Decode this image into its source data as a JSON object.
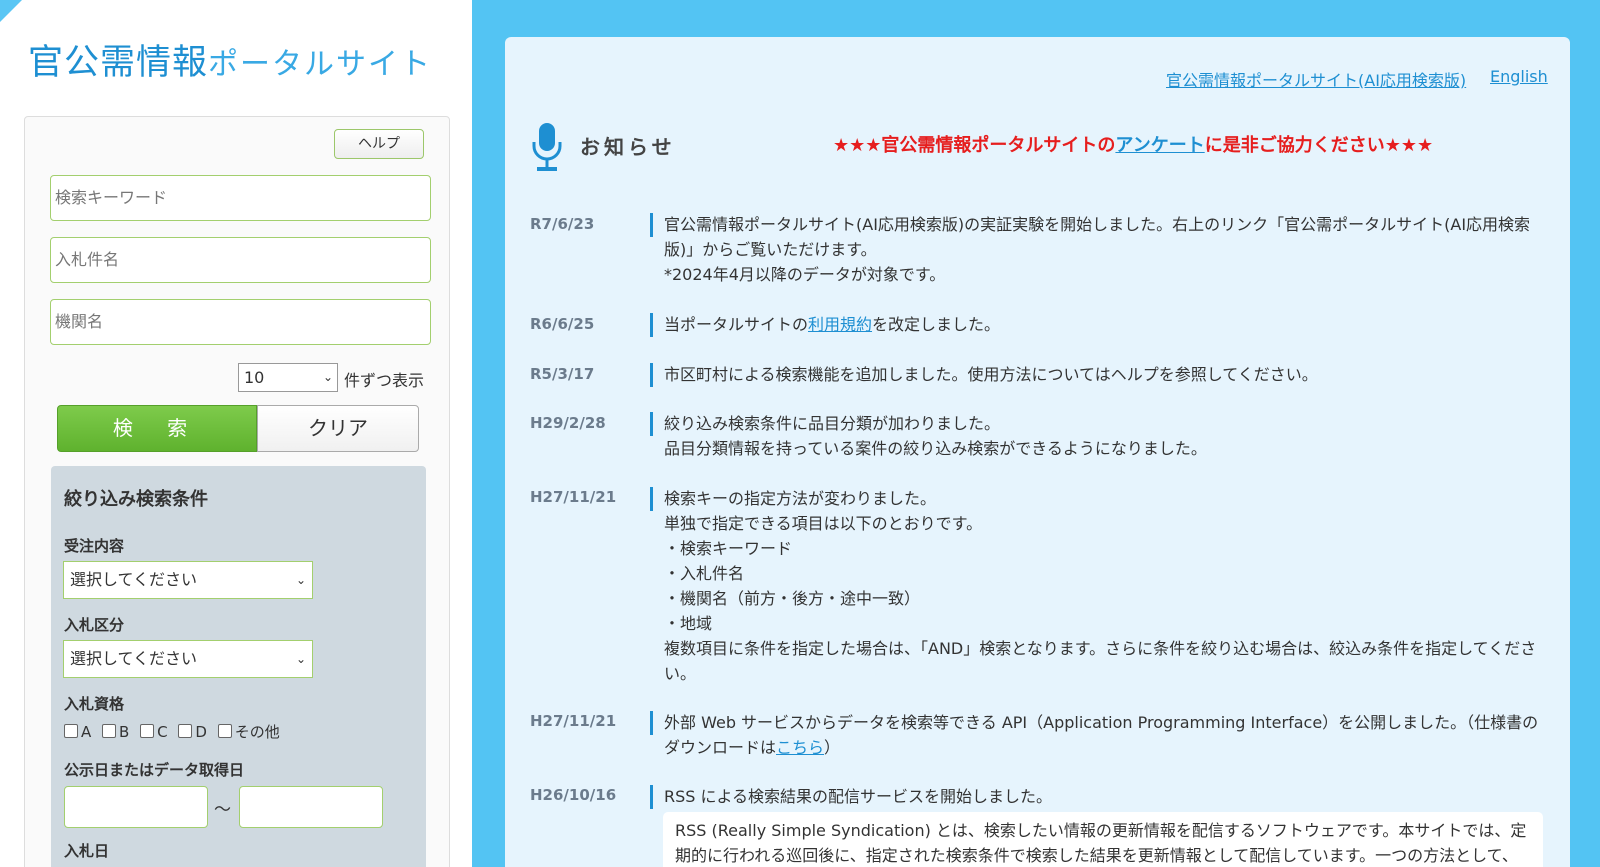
{
  "logo": {
    "main": "官公需情報",
    "sub": "ポータルサイト"
  },
  "search": {
    "help_label": "ヘルプ",
    "keyword_placeholder": "検索キーワード",
    "title_placeholder": "入札件名",
    "agency_placeholder": "機関名",
    "per_page_value": "10",
    "per_page_label": "件ずつ表示",
    "search_label": "検 索",
    "clear_label": "クリア"
  },
  "filter": {
    "title": "絞り込み検索条件",
    "order_label": "受注内容",
    "order_value": "選択してください",
    "bid_type_label": "入札区分",
    "bid_type_value": "選択してください",
    "qual_label": "入札資格",
    "qual_options": [
      "A",
      "B",
      "C",
      "D",
      "その他"
    ],
    "date_label": "公示日またはデータ取得日",
    "date_sep": "～",
    "bid_date_label": "入札日"
  },
  "header_links": {
    "ai": "官公需情報ポータルサイト(AI応用検索版)",
    "english": "English"
  },
  "news": {
    "title": "お知らせ",
    "survey_pre": "★★★官公需情報ポータルサイトの",
    "survey_link": "アンケート",
    "survey_post": "に是非ご協力ください★★★",
    "items": [
      {
        "date": "R7/6/23",
        "lines": [
          "官公需情報ポータルサイト(AI応用検索版)の実証実験を開始しました。右上のリンク「官公需ポータルサイト(AI応用検索版)」からご覧いただけます。",
          "*2024年4月以降のデータが対象です。"
        ]
      },
      {
        "date": "R6/6/25",
        "pre": "当ポータルサイトの",
        "link": "利用規約",
        "post": "を改定しました。"
      },
      {
        "date": "R5/3/17",
        "lines": [
          "市区町村による検索機能を追加しました。使用方法についてはヘルプを参照してください。"
        ]
      },
      {
        "date": "H29/2/28",
        "lines": [
          "絞り込み検索条件に品目分類が加わりました。",
          "品目分類情報を持っている案件の絞り込み検索ができるようになりました。"
        ]
      },
      {
        "date": "H27/11/21",
        "lines": [
          "検索キーの指定方法が変わりました。",
          "単独で指定できる項目は以下のとおりです。",
          "・検索キーワード",
          "・入札件名",
          "・機関名（前方・後方・途中一致）",
          "・地域",
          "複数項目に条件を指定した場合は、「AND」検索となります。さらに条件を絞り込む場合は、絞込み条件を指定してください。"
        ]
      },
      {
        "date": "H27/11/21",
        "pre": "外部 Web サービスからデータを検索等できる API（Application Programming Interface）を公開しました。（仕様書のダウンロードは",
        "link": "こちら",
        "post": "）"
      },
      {
        "date": "H26/10/16",
        "lines": [
          "RSS による検索結果の配信サービスを開始しました。"
        ]
      }
    ],
    "rss_box": "RSS (Really Simple Syndication) とは、検索したい情報の更新情報を配信するソフトウェアです。本サイトでは、定期的に行われる巡回後に、指定された検索条件で検索した結果を更新情報として配信しています。一つの方法として、"
  }
}
